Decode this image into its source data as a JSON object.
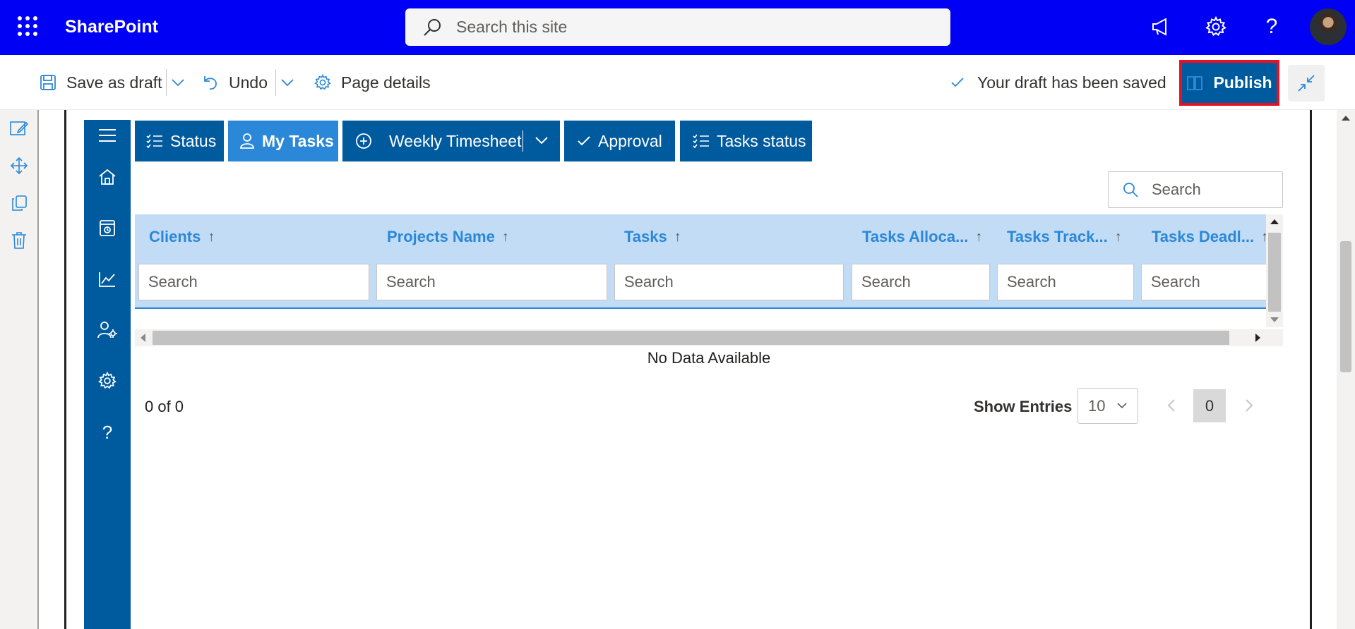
{
  "suite": {
    "brand": "SharePoint",
    "search_placeholder": "Search this site"
  },
  "command_bar": {
    "save_label": "Save as draft",
    "undo_label": "Undo",
    "page_details_label": "Page details",
    "saved_status": "Your draft has been saved",
    "publish_label": "Publish"
  },
  "tabs": [
    {
      "label": "Status",
      "icon": "checklist-icon",
      "active": false
    },
    {
      "label": "My Tasks",
      "icon": "person-icon",
      "active": true
    },
    {
      "label": "Weekly Timesheet",
      "icon": "add-circle-icon",
      "active": false
    },
    {
      "label": "Approval",
      "icon": "check-icon",
      "active": false
    },
    {
      "label": "Tasks status",
      "icon": "checklist-icon",
      "active": false
    }
  ],
  "grid": {
    "search_placeholder": "Search",
    "columns": [
      {
        "label": "Clients",
        "filter_placeholder": "Search"
      },
      {
        "label": "Projects Name",
        "filter_placeholder": "Search"
      },
      {
        "label": "Tasks",
        "filter_placeholder": "Search"
      },
      {
        "label": "Tasks Alloca...",
        "filter_placeholder": "Search"
      },
      {
        "label": "Tasks Track...",
        "filter_placeholder": "Search"
      },
      {
        "label": "Tasks Deadl...",
        "filter_placeholder": "Search"
      }
    ],
    "sort_arrow": "↑",
    "empty_message": "No Data Available",
    "record_count": "0 of 0",
    "show_entries_label": "Show Entries",
    "entries_value": "10",
    "current_page": "0"
  },
  "colors": {
    "suite_bar": "#0000f5",
    "primary": "#005a9e",
    "active_tab": "#2b88d8",
    "header_bg": "#c2dcf5",
    "highlight_border": "#e81123"
  }
}
